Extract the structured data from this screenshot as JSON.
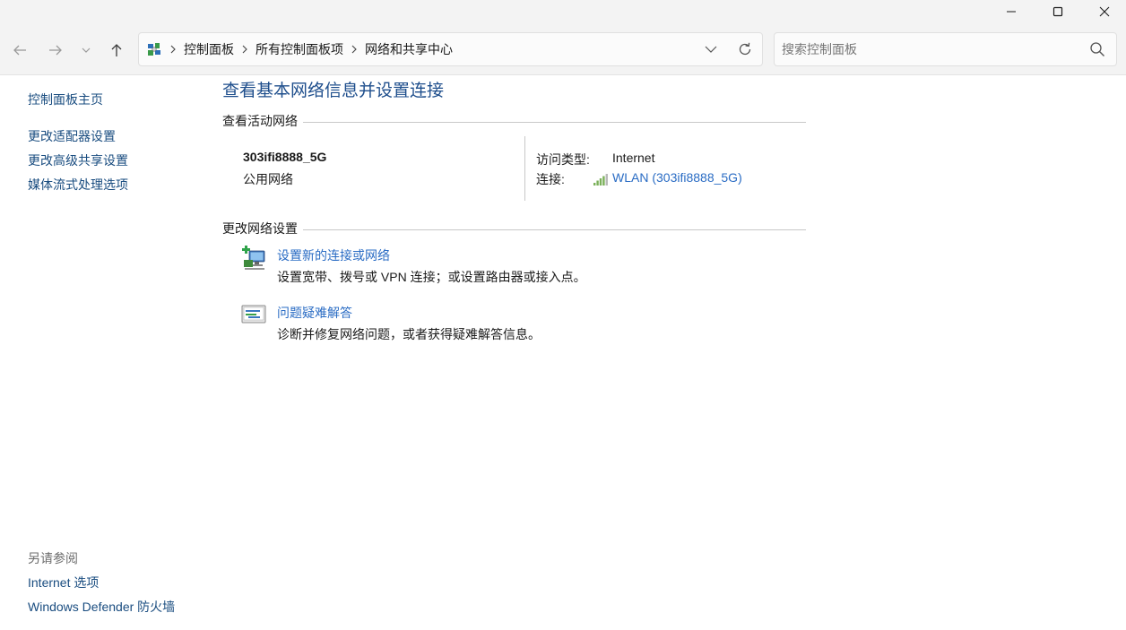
{
  "window": {
    "controls": [
      "minimize-icon",
      "maximize-icon",
      "close-icon"
    ]
  },
  "nav": {
    "icons": [
      "back-arrow-icon",
      "forward-arrow-icon",
      "recent-locations-icon",
      "up-arrow-icon"
    ]
  },
  "address": {
    "icon": "control-panel-icon",
    "breadcrumbs": [
      "控制面板",
      "所有控制面板项",
      "网络和共享中心"
    ]
  },
  "search": {
    "placeholder": "搜索控制面板",
    "icon": "search-icon"
  },
  "sidebar": {
    "home": "控制面板主页",
    "links": [
      "更改适配器设置",
      "更改高级共享设置",
      "媒体流式处理选项"
    ],
    "see_also_title": "另请参阅",
    "see_also": [
      "Internet 选项",
      "Windows Defender 防火墙"
    ]
  },
  "main": {
    "title": "查看基本网络信息并设置连接",
    "active_section": "查看活动网络",
    "network": {
      "name": "303ifi8888_5G",
      "category": "公用网络",
      "access_label": "访问类型:",
      "access_value": "Internet",
      "connection_label": "连接:",
      "connection_value": "WLAN (303ifi8888_5G)",
      "connection_icon": "wifi-signal-icon"
    },
    "change_section": "更改网络设置",
    "tasks": [
      {
        "title": "设置新的连接或网络",
        "desc": "设置宽带、拨号或 VPN 连接；或设置路由器或接入点。",
        "icon": "new-connection-icon"
      },
      {
        "title": "问题疑难解答",
        "desc": "诊断并修复网络问题，或者获得疑难解答信息。",
        "icon": "troubleshoot-icon"
      }
    ]
  },
  "colors": {
    "link": "#2a6cc4",
    "title": "#1e4e8c",
    "sidebar_link": "#1a4d80",
    "chrome": "#f3f3f3"
  }
}
